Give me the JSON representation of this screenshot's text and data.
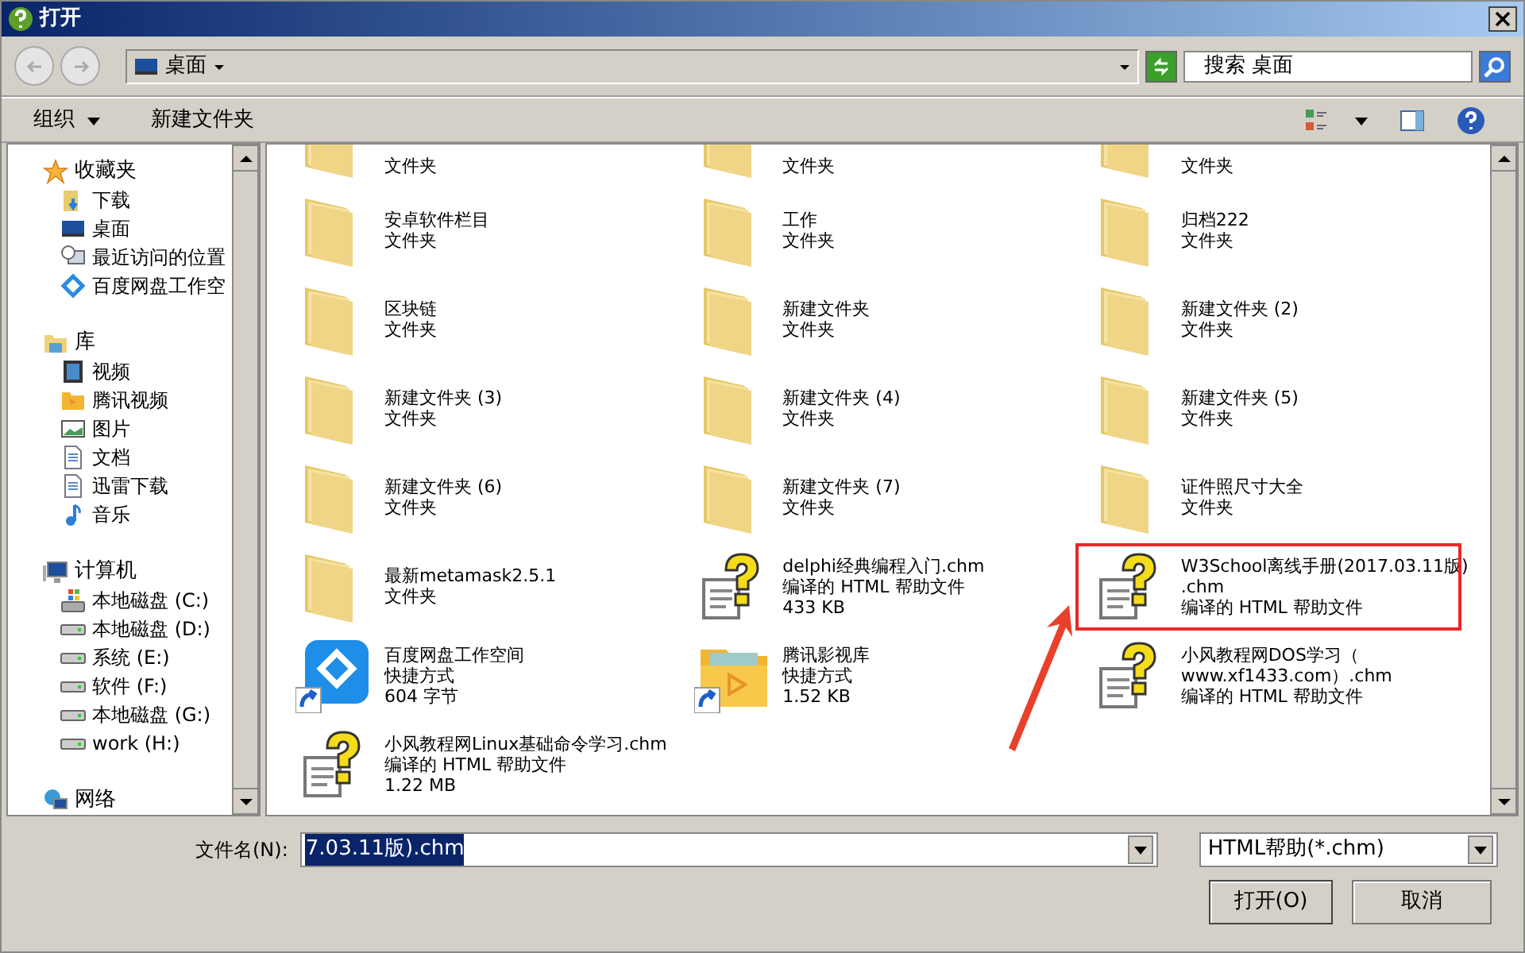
{
  "window": {
    "title": "打开"
  },
  "address": {
    "location": "桌面",
    "search_placeholder": "搜索 桌面"
  },
  "toolbar": {
    "organize": "组织",
    "new_folder": "新建文件夹"
  },
  "sidebar": [
    {
      "label": "收藏夹",
      "kind": "star",
      "children": [
        {
          "label": "下载",
          "kind": "download"
        },
        {
          "label": "桌面",
          "kind": "desktop"
        },
        {
          "label": "最近访问的位置",
          "kind": "recent"
        },
        {
          "label": "百度网盘工作空",
          "kind": "baidu"
        }
      ]
    },
    {
      "label": "库",
      "kind": "library",
      "children": [
        {
          "label": "视频",
          "kind": "video"
        },
        {
          "label": "腾讯视频",
          "kind": "tencent"
        },
        {
          "label": "图片",
          "kind": "picture"
        },
        {
          "label": "文档",
          "kind": "document"
        },
        {
          "label": "迅雷下载",
          "kind": "document"
        },
        {
          "label": "音乐",
          "kind": "music"
        }
      ]
    },
    {
      "label": "计算机",
      "kind": "computer",
      "children": [
        {
          "label": "本地磁盘 (C:)",
          "kind": "sysdrive"
        },
        {
          "label": "本地磁盘 (D:)",
          "kind": "drive"
        },
        {
          "label": "系统 (E:)",
          "kind": "drive"
        },
        {
          "label": "软件 (F:)",
          "kind": "drive"
        },
        {
          "label": "本地磁盘 (G:)",
          "kind": "drive"
        },
        {
          "label": "work (H:)",
          "kind": "drive"
        }
      ]
    },
    {
      "label": "网络",
      "kind": "network"
    }
  ],
  "files": [
    {
      "kind": "folder",
      "lines": [
        "文件夹"
      ],
      "highlighted": false
    },
    {
      "kind": "folder",
      "lines": [
        "文件夹"
      ],
      "highlighted": false
    },
    {
      "kind": "folder",
      "lines": [
        "文件夹"
      ],
      "highlighted": false
    },
    {
      "kind": "folder",
      "lines": [
        "安卓软件栏目",
        "文件夹"
      ],
      "highlighted": false
    },
    {
      "kind": "folder",
      "lines": [
        "工作",
        "文件夹"
      ],
      "highlighted": false
    },
    {
      "kind": "folder",
      "lines": [
        "归档222",
        "文件夹"
      ],
      "highlighted": false
    },
    {
      "kind": "folder",
      "lines": [
        "区块链",
        "文件夹"
      ],
      "highlighted": false
    },
    {
      "kind": "folder",
      "lines": [
        "新建文件夹",
        "文件夹"
      ],
      "highlighted": false
    },
    {
      "kind": "folder",
      "lines": [
        "新建文件夹 (2)",
        "文件夹"
      ],
      "highlighted": false
    },
    {
      "kind": "folder",
      "lines": [
        "新建文件夹 (3)",
        "文件夹"
      ],
      "highlighted": false
    },
    {
      "kind": "folder",
      "lines": [
        "新建文件夹 (4)",
        "文件夹"
      ],
      "highlighted": false
    },
    {
      "kind": "folder",
      "lines": [
        "新建文件夹 (5)",
        "文件夹"
      ],
      "highlighted": false
    },
    {
      "kind": "folder",
      "lines": [
        "新建文件夹 (6)",
        "文件夹"
      ],
      "highlighted": false
    },
    {
      "kind": "folder",
      "lines": [
        "新建文件夹 (7)",
        "文件夹"
      ],
      "highlighted": false
    },
    {
      "kind": "folder",
      "lines": [
        "证件照尺寸大全",
        "文件夹"
      ],
      "highlighted": false
    },
    {
      "kind": "folder",
      "lines": [
        "最新metamask2.5.1",
        "文件夹"
      ],
      "highlighted": false
    },
    {
      "kind": "chm",
      "lines": [
        "delphi经典编程入门.chm",
        "编译的 HTML 帮助文件",
        "433 KB"
      ],
      "highlighted": false
    },
    {
      "kind": "chm",
      "lines": [
        "W3School离线手册(2017.03.11版)",
        ".chm",
        "编译的 HTML 帮助文件"
      ],
      "highlighted": true
    },
    {
      "kind": "app_shortcut",
      "lines": [
        "百度网盘工作空间",
        "快捷方式",
        "604 字节"
      ],
      "highlighted": false
    },
    {
      "kind": "folder_shortcut",
      "lines": [
        "腾讯影视库",
        "快捷方式",
        "1.52 KB"
      ],
      "highlighted": false
    },
    {
      "kind": "chm",
      "lines": [
        "小风教程网DOS学习（",
        "www.xf1433.com）.chm",
        "编译的 HTML 帮助文件"
      ],
      "highlighted": false
    },
    {
      "kind": "chm",
      "lines": [
        "小风教程网Linux基础命令学习.chm",
        "编译的 HTML 帮助文件",
        "1.22 MB"
      ],
      "highlighted": false
    }
  ],
  "footer": {
    "filename_label": "文件名(N):",
    "filename_value": "7.03.11版).chm",
    "filter": "HTML帮助(*.chm)",
    "open": "打开(O)",
    "cancel": "取消"
  }
}
